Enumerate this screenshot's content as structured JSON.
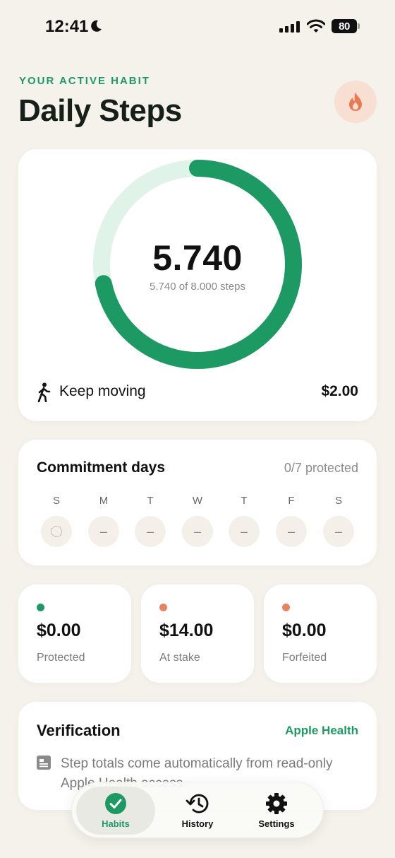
{
  "status": {
    "time": "12:41",
    "battery": "80"
  },
  "header": {
    "eyebrow": "YOUR ACTIVE HABIT",
    "title": "Daily Steps"
  },
  "progress": {
    "value": "5.740",
    "subtitle": "5.740 of 8.000 steps",
    "fraction": 0.7175,
    "status_label": "Keep moving",
    "amount": "$2.00"
  },
  "commitment": {
    "title": "Commitment days",
    "count": "0/7 protected",
    "days": [
      {
        "letter": "S",
        "mark": ""
      },
      {
        "letter": "M",
        "mark": "–"
      },
      {
        "letter": "T",
        "mark": "–"
      },
      {
        "letter": "W",
        "mark": "–"
      },
      {
        "letter": "T",
        "mark": "–"
      },
      {
        "letter": "F",
        "mark": "–"
      },
      {
        "letter": "S",
        "mark": "–"
      }
    ]
  },
  "stats": [
    {
      "value": "$0.00",
      "label": "Protected",
      "color": "#1d9a63"
    },
    {
      "value": "$14.00",
      "label": "At stake",
      "color": "#e8835f"
    },
    {
      "value": "$0.00",
      "label": "Forfeited",
      "color": "#e8835f"
    }
  ],
  "verification": {
    "title": "Verification",
    "source": "Apple Health",
    "text": "Step totals come automatically from read-only Apple Health access."
  },
  "tabs": [
    {
      "label": "Habits"
    },
    {
      "label": "History"
    },
    {
      "label": "Settings"
    }
  ],
  "colors": {
    "accent": "#1d9a63",
    "ring_track": "#dff3e8",
    "streak": "#e97a54"
  }
}
